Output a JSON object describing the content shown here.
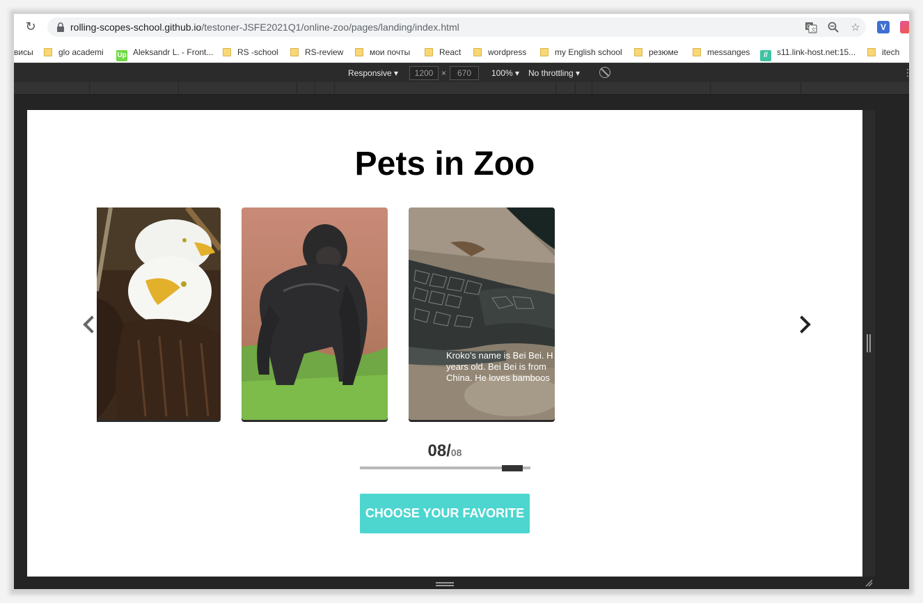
{
  "browser": {
    "url_host": "rolling-scopes-school.github.io",
    "url_path": "/testoner-JSFE2021Q1/online-zoo/pages/landing/index.html",
    "icons": [
      "reload-icon",
      "lock-icon",
      "translate-icon",
      "zoom-icon",
      "star-icon"
    ]
  },
  "bookmarks": [
    {
      "label": "висы",
      "icon": "none"
    },
    {
      "label": "glo academi",
      "icon": "folder-icon"
    },
    {
      "label": "Aleksandr L. - Front...",
      "icon": "upwork-icon"
    },
    {
      "label": "RS -school",
      "icon": "folder-icon"
    },
    {
      "label": "RS-review",
      "icon": "folder-icon"
    },
    {
      "label": "мои почты",
      "icon": "folder-icon"
    },
    {
      "label": "React",
      "icon": "folder-icon"
    },
    {
      "label": "wordpress",
      "icon": "folder-icon"
    },
    {
      "label": "my English school",
      "icon": "folder-icon"
    },
    {
      "label": "резюме",
      "icon": "folder-icon"
    },
    {
      "label": "messanges",
      "icon": "folder-icon"
    },
    {
      "label": "s11.link-host.net:15...",
      "icon": "link-host-icon"
    },
    {
      "label": "itech",
      "icon": "folder-icon"
    }
  ],
  "devtools": {
    "device": "Responsive",
    "width": "1200",
    "times": "×",
    "height": "670",
    "zoom": "100%",
    "throttling": "No throttling"
  },
  "page": {
    "title": "Pets in Zoo",
    "cards": [
      {
        "name": "eagle",
        "image": "bald-eagles-photo"
      },
      {
        "name": "gorilla",
        "image": "gorilla-photo"
      },
      {
        "name": "crocodile",
        "image": "crocodile-photo",
        "text_line1": "Kroko's name is Bei Bei. H",
        "text_line2": "years old. Bei Bei is from",
        "text_line3": "China. He loves bamboos"
      }
    ],
    "counter_current": "08/",
    "counter_total": "08",
    "progress": 0.88,
    "cta_label": "CHOOSE YOUR FAVORITE",
    "colors": {
      "cta": "#4dd6cf",
      "progress_thumb": "#333333",
      "progress_track": "#b8b8b8"
    }
  }
}
